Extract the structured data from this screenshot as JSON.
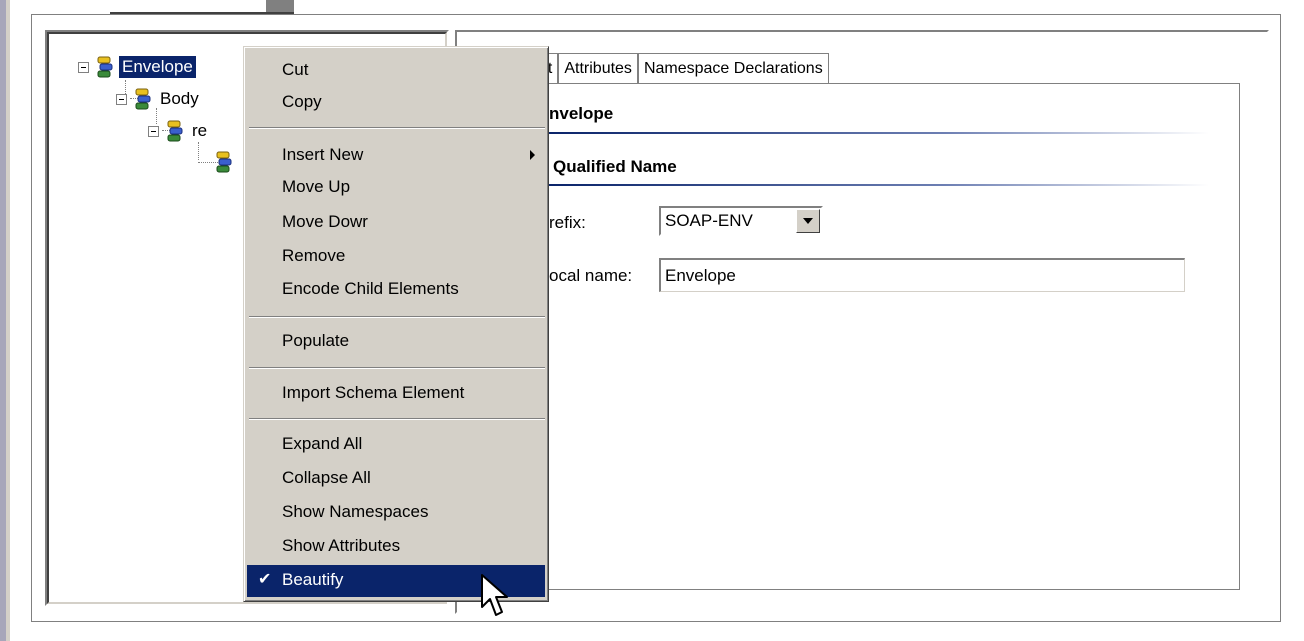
{
  "tree": {
    "nodes": [
      {
        "label": "Envelope",
        "selected": true
      },
      {
        "label": "Body"
      },
      {
        "label": "re"
      }
    ]
  },
  "tabs": [
    {
      "label": "nt"
    },
    {
      "label": "Attributes"
    },
    {
      "label": "Namespace Declarations"
    }
  ],
  "details": {
    "element_title": "nvelope",
    "qualified_name_title": "Qualified Name",
    "prefix_label": "refix:",
    "prefix_value": "SOAP-ENV",
    "local_name_label": "ocal name:",
    "local_name_value": "Envelope"
  },
  "context_menu": {
    "items": [
      {
        "label": "Cut"
      },
      {
        "label": "Copy"
      },
      {
        "label": "Insert New",
        "submenu": true
      },
      {
        "label": "Move Up"
      },
      {
        "label": "Move Dowr"
      },
      {
        "label": "Remove"
      },
      {
        "label": "Encode Child Elements"
      },
      {
        "label": "Populate"
      },
      {
        "label": "Import Schema Element"
      },
      {
        "label": "Expand All"
      },
      {
        "label": "Collapse All"
      },
      {
        "label": "Show Namespaces"
      },
      {
        "label": "Show Attributes"
      },
      {
        "label": "Beautify",
        "checked": true,
        "highlighted": true
      }
    ],
    "check_glyph": "✔"
  },
  "colors": {
    "selection": "#0a246a",
    "menu_bg": "#d4d0c8",
    "node_icon_green": "#3a8a3a",
    "node_icon_blue": "#3a5fcd",
    "node_icon_yellow": "#e8c020"
  },
  "icons": [
    "node-element-icon",
    "submenu-arrow-icon",
    "check-icon",
    "mouse-pointer-icon",
    "dropdown-arrow-icon"
  ]
}
